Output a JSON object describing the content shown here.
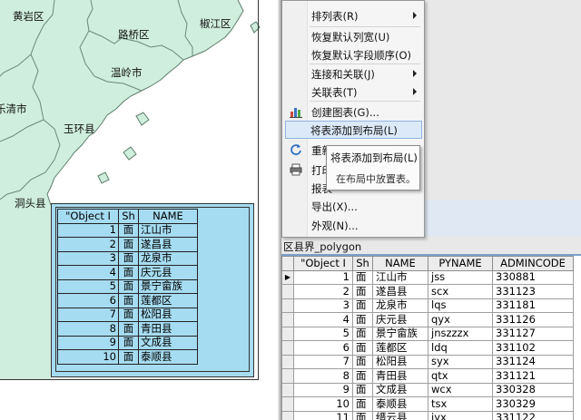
{
  "map": {
    "labels": [
      "黄岩区",
      "路桥区",
      "椒江区",
      "温岭市",
      "乐清市",
      "玉环县",
      "洞头县"
    ],
    "land_color": "#cfeedd",
    "boundary_color": "#6a8a78"
  },
  "layout_table": {
    "headers": [
      "\"Object I",
      "Sh",
      "NAME"
    ],
    "rows": [
      [
        "1",
        "面",
        "江山市"
      ],
      [
        "2",
        "面",
        "遂昌县"
      ],
      [
        "3",
        "面",
        "龙泉市"
      ],
      [
        "4",
        "面",
        "庆元县"
      ],
      [
        "5",
        "面",
        "景宁畲族"
      ],
      [
        "6",
        "面",
        "莲都区"
      ],
      [
        "7",
        "面",
        "松阳县"
      ],
      [
        "8",
        "面",
        "青田县"
      ],
      [
        "9",
        "面",
        "文成县"
      ],
      [
        "10",
        "面",
        "泰顺县"
      ]
    ],
    "fill_color": "#a6dcf1"
  },
  "context_menu": {
    "items": [
      {
        "label": "排列表(R)",
        "submenu": true
      },
      {
        "label": "恢复默认列宽(U)",
        "submenu": false
      },
      {
        "label": "恢复默认字段顺序(O)",
        "submenu": false
      },
      {
        "label": "连接和关联(J)",
        "submenu": true
      },
      {
        "label": "关联表(T)",
        "submenu": true
      },
      {
        "label": "创建图表(G)...",
        "submenu": false
      },
      {
        "label": "将表添加到布局(L)",
        "submenu": false,
        "highlighted": true
      },
      {
        "label": "重新",
        "submenu": false
      },
      {
        "label": "打印",
        "submenu": false
      },
      {
        "label": "报表",
        "submenu": false
      },
      {
        "label": "导出(X)...",
        "submenu": false
      },
      {
        "label": "外观(N)...",
        "submenu": false
      }
    ]
  },
  "tooltip": {
    "title": "将表添加到布局(L)",
    "description": "在布局中放置表。"
  },
  "attribute_table": {
    "tab_label": "区县界_polygon",
    "headers": [
      "\"Object I",
      "Sh",
      "NAME",
      "PYNAME",
      "ADMINCODE"
    ],
    "rows": [
      [
        "1",
        "面",
        "江山市",
        "jss",
        "330881"
      ],
      [
        "2",
        "面",
        "遂昌县",
        "scx",
        "331123"
      ],
      [
        "3",
        "面",
        "龙泉市",
        "lqs",
        "331181"
      ],
      [
        "4",
        "面",
        "庆元县",
        "qyx",
        "331126"
      ],
      [
        "5",
        "面",
        "景宁畲族",
        "jnszzzx",
        "331127"
      ],
      [
        "6",
        "面",
        "莲都区",
        "ldq",
        "331102"
      ],
      [
        "7",
        "面",
        "松阳县",
        "syx",
        "331124"
      ],
      [
        "8",
        "面",
        "青田县",
        "qtx",
        "331121"
      ],
      [
        "9",
        "面",
        "文成县",
        "wcx",
        "330328"
      ],
      [
        "10",
        "面",
        "泰顺县",
        "tsx",
        "330329"
      ],
      [
        "11",
        "面",
        "缙云县",
        "jyx",
        "331122"
      ]
    ],
    "selected_row_marker": "▶"
  }
}
